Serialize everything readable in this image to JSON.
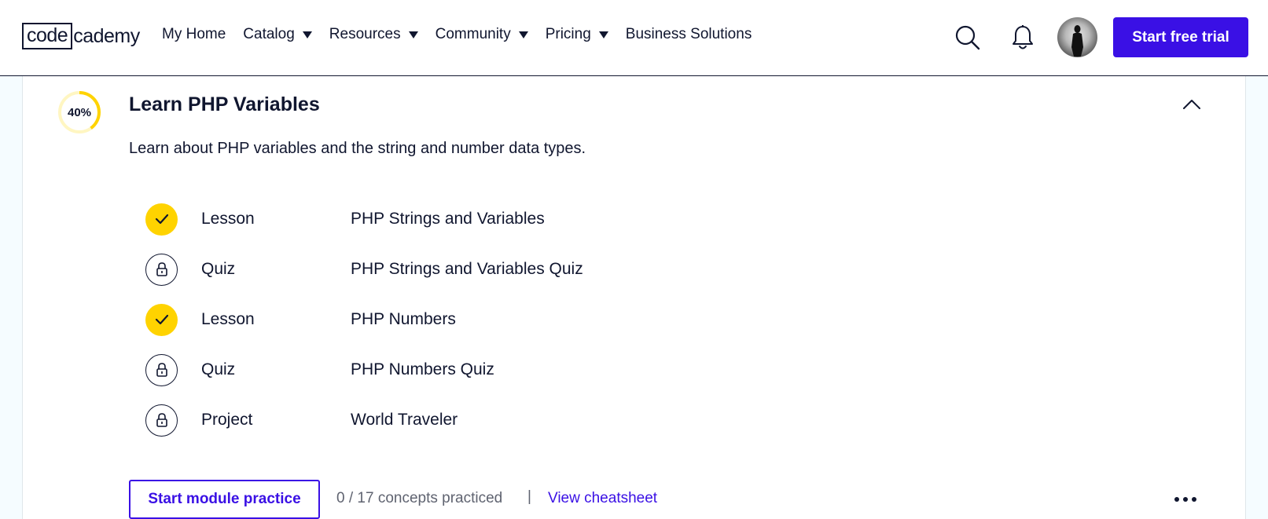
{
  "header": {
    "logo_box": "code",
    "logo_rest": "cademy",
    "nav": [
      {
        "label": "My Home",
        "has_caret": false
      },
      {
        "label": "Catalog",
        "has_caret": true
      },
      {
        "label": "Resources",
        "has_caret": true
      },
      {
        "label": "Community",
        "has_caret": true
      },
      {
        "label": "Pricing",
        "has_caret": true
      },
      {
        "label": "Business Solutions",
        "has_caret": false
      }
    ],
    "icons": {
      "search": "search-icon",
      "notifications": "bell-icon",
      "avatar": "avatar"
    },
    "cta_label": "Start free trial"
  },
  "module": {
    "progress_label": "40%",
    "progress_value": 0.4,
    "title": "Learn PHP Variables",
    "description": "Learn about PHP variables and the string and number data types.",
    "items": [
      {
        "type": "Lesson",
        "name": "PHP Strings and Variables",
        "status": "completed"
      },
      {
        "type": "Quiz",
        "name": "PHP Strings and Variables Quiz",
        "status": "locked"
      },
      {
        "type": "Lesson",
        "name": "PHP Numbers",
        "status": "completed"
      },
      {
        "type": "Quiz",
        "name": "PHP Numbers Quiz",
        "status": "locked"
      },
      {
        "type": "Project",
        "name": "World Traveler",
        "status": "locked"
      }
    ],
    "practice_button": "Start module practice",
    "concepts_text": "0 / 17 concepts practiced",
    "separator": "|",
    "cheatsheet_link": "View cheatsheet"
  },
  "colors": {
    "accent": "#3a10e5",
    "completed": "#ffd300",
    "text": "#10162f",
    "muted": "#5f6370",
    "page_bg": "#f5fcff"
  }
}
